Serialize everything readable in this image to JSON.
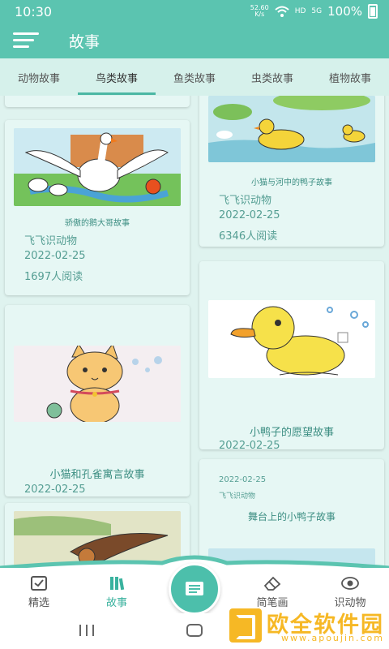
{
  "status_bar": {
    "time": "10:30",
    "net_speed_top": "52.60",
    "net_speed_bottom": "K/s",
    "hd": "HD",
    "signal": "5G",
    "battery": "100%"
  },
  "app_bar": {
    "title": "故事"
  },
  "tabs": [
    {
      "label": "动物故事"
    },
    {
      "label": "鸟类故事"
    },
    {
      "label": "鱼类故事"
    },
    {
      "label": "虫类故事"
    },
    {
      "label": "植物故事"
    }
  ],
  "active_tab": "鸟类故事",
  "cards": {
    "goose": {
      "title": "骄傲的鹅大哥故事",
      "author": "飞飞识动物",
      "date": "2022-02-25",
      "reads": "1697人阅读"
    },
    "duck_river": {
      "title": "小猫与河中的鸭子故事",
      "author": "飞飞识动物",
      "date": "2022-02-25",
      "reads": "6346人阅读"
    },
    "cat": {
      "title": "小猫和孔雀寓言故事",
      "date": "2022-02-25"
    },
    "duckling": {
      "title": "小鸭子的愿望故事",
      "date": "2022-02-25"
    },
    "stage_duck": {
      "date": "2022-02-25",
      "author": "飞飞识动物",
      "title": "舞台上的小鸭子故事"
    }
  },
  "bottom_nav": [
    {
      "label": "精选",
      "icon": "featured-icon"
    },
    {
      "label": "故事",
      "icon": "books-icon"
    },
    {
      "label": "",
      "icon": "open-book-icon"
    },
    {
      "label": "简笔画",
      "icon": "eraser-icon"
    },
    {
      "label": "识动物",
      "icon": "eye-icon"
    }
  ],
  "watermark": {
    "title": "欧全软件园",
    "url": "www.apoujin.com"
  },
  "colors": {
    "primary": "#5bc4b0",
    "accent": "#3ab29e",
    "card_bg": "#e6f7f4"
  }
}
